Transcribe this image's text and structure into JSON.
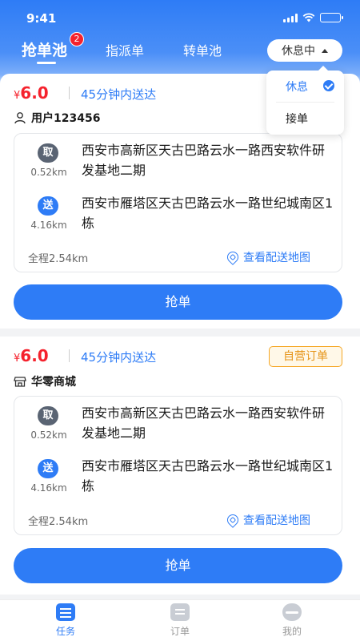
{
  "status_bar": {
    "time": "9:41"
  },
  "tabs": [
    {
      "label": "抢单池",
      "badge": "2",
      "active": true
    },
    {
      "label": "指派单"
    },
    {
      "label": "转单池"
    }
  ],
  "work_status": {
    "current": "休息中",
    "options": [
      {
        "label": "休息",
        "selected": true
      },
      {
        "label": "接单",
        "selected": false
      }
    ]
  },
  "orders": [
    {
      "currency": "¥",
      "price": "6.0",
      "delivery_time": "45分钟内送达",
      "customer": "用户123456",
      "customer_icon": "user-icon",
      "pickup": {
        "tag": "取",
        "distance": "0.52km",
        "address": "西安市高新区天古巴路云水一路西安软件研发基地二期"
      },
      "dropoff": {
        "tag": "送",
        "distance": "4.16km",
        "address": "西安市雁塔区天古巴路云水一路世纪城南区1栋"
      },
      "total_distance": "全程2.54km",
      "map_link": "查看配送地图",
      "button": "抢单"
    },
    {
      "currency": "¥",
      "price": "6.0",
      "delivery_time": "45分钟内送达",
      "customer": "华零商城",
      "customer_icon": "shop-icon",
      "tag": "自营订单",
      "pickup": {
        "tag": "取",
        "distance": "0.52km",
        "address": "西安市高新区天古巴路云水一路西安软件研发基地二期"
      },
      "dropoff": {
        "tag": "送",
        "distance": "4.16km",
        "address": "西安市雁塔区天古巴路云水一路世纪城南区1栋"
      },
      "total_distance": "全程2.54km",
      "map_link": "查看配送地图",
      "button": "抢单"
    }
  ],
  "tabbar": [
    {
      "label": "任务",
      "icon": "task-icon",
      "active": true
    },
    {
      "label": "订单",
      "icon": "orders-icon"
    },
    {
      "label": "我的",
      "icon": "profile-icon"
    }
  ],
  "colors": {
    "primary": "#2e7cf6",
    "price": "#f5222d",
    "self_tag": "#e6951a"
  }
}
